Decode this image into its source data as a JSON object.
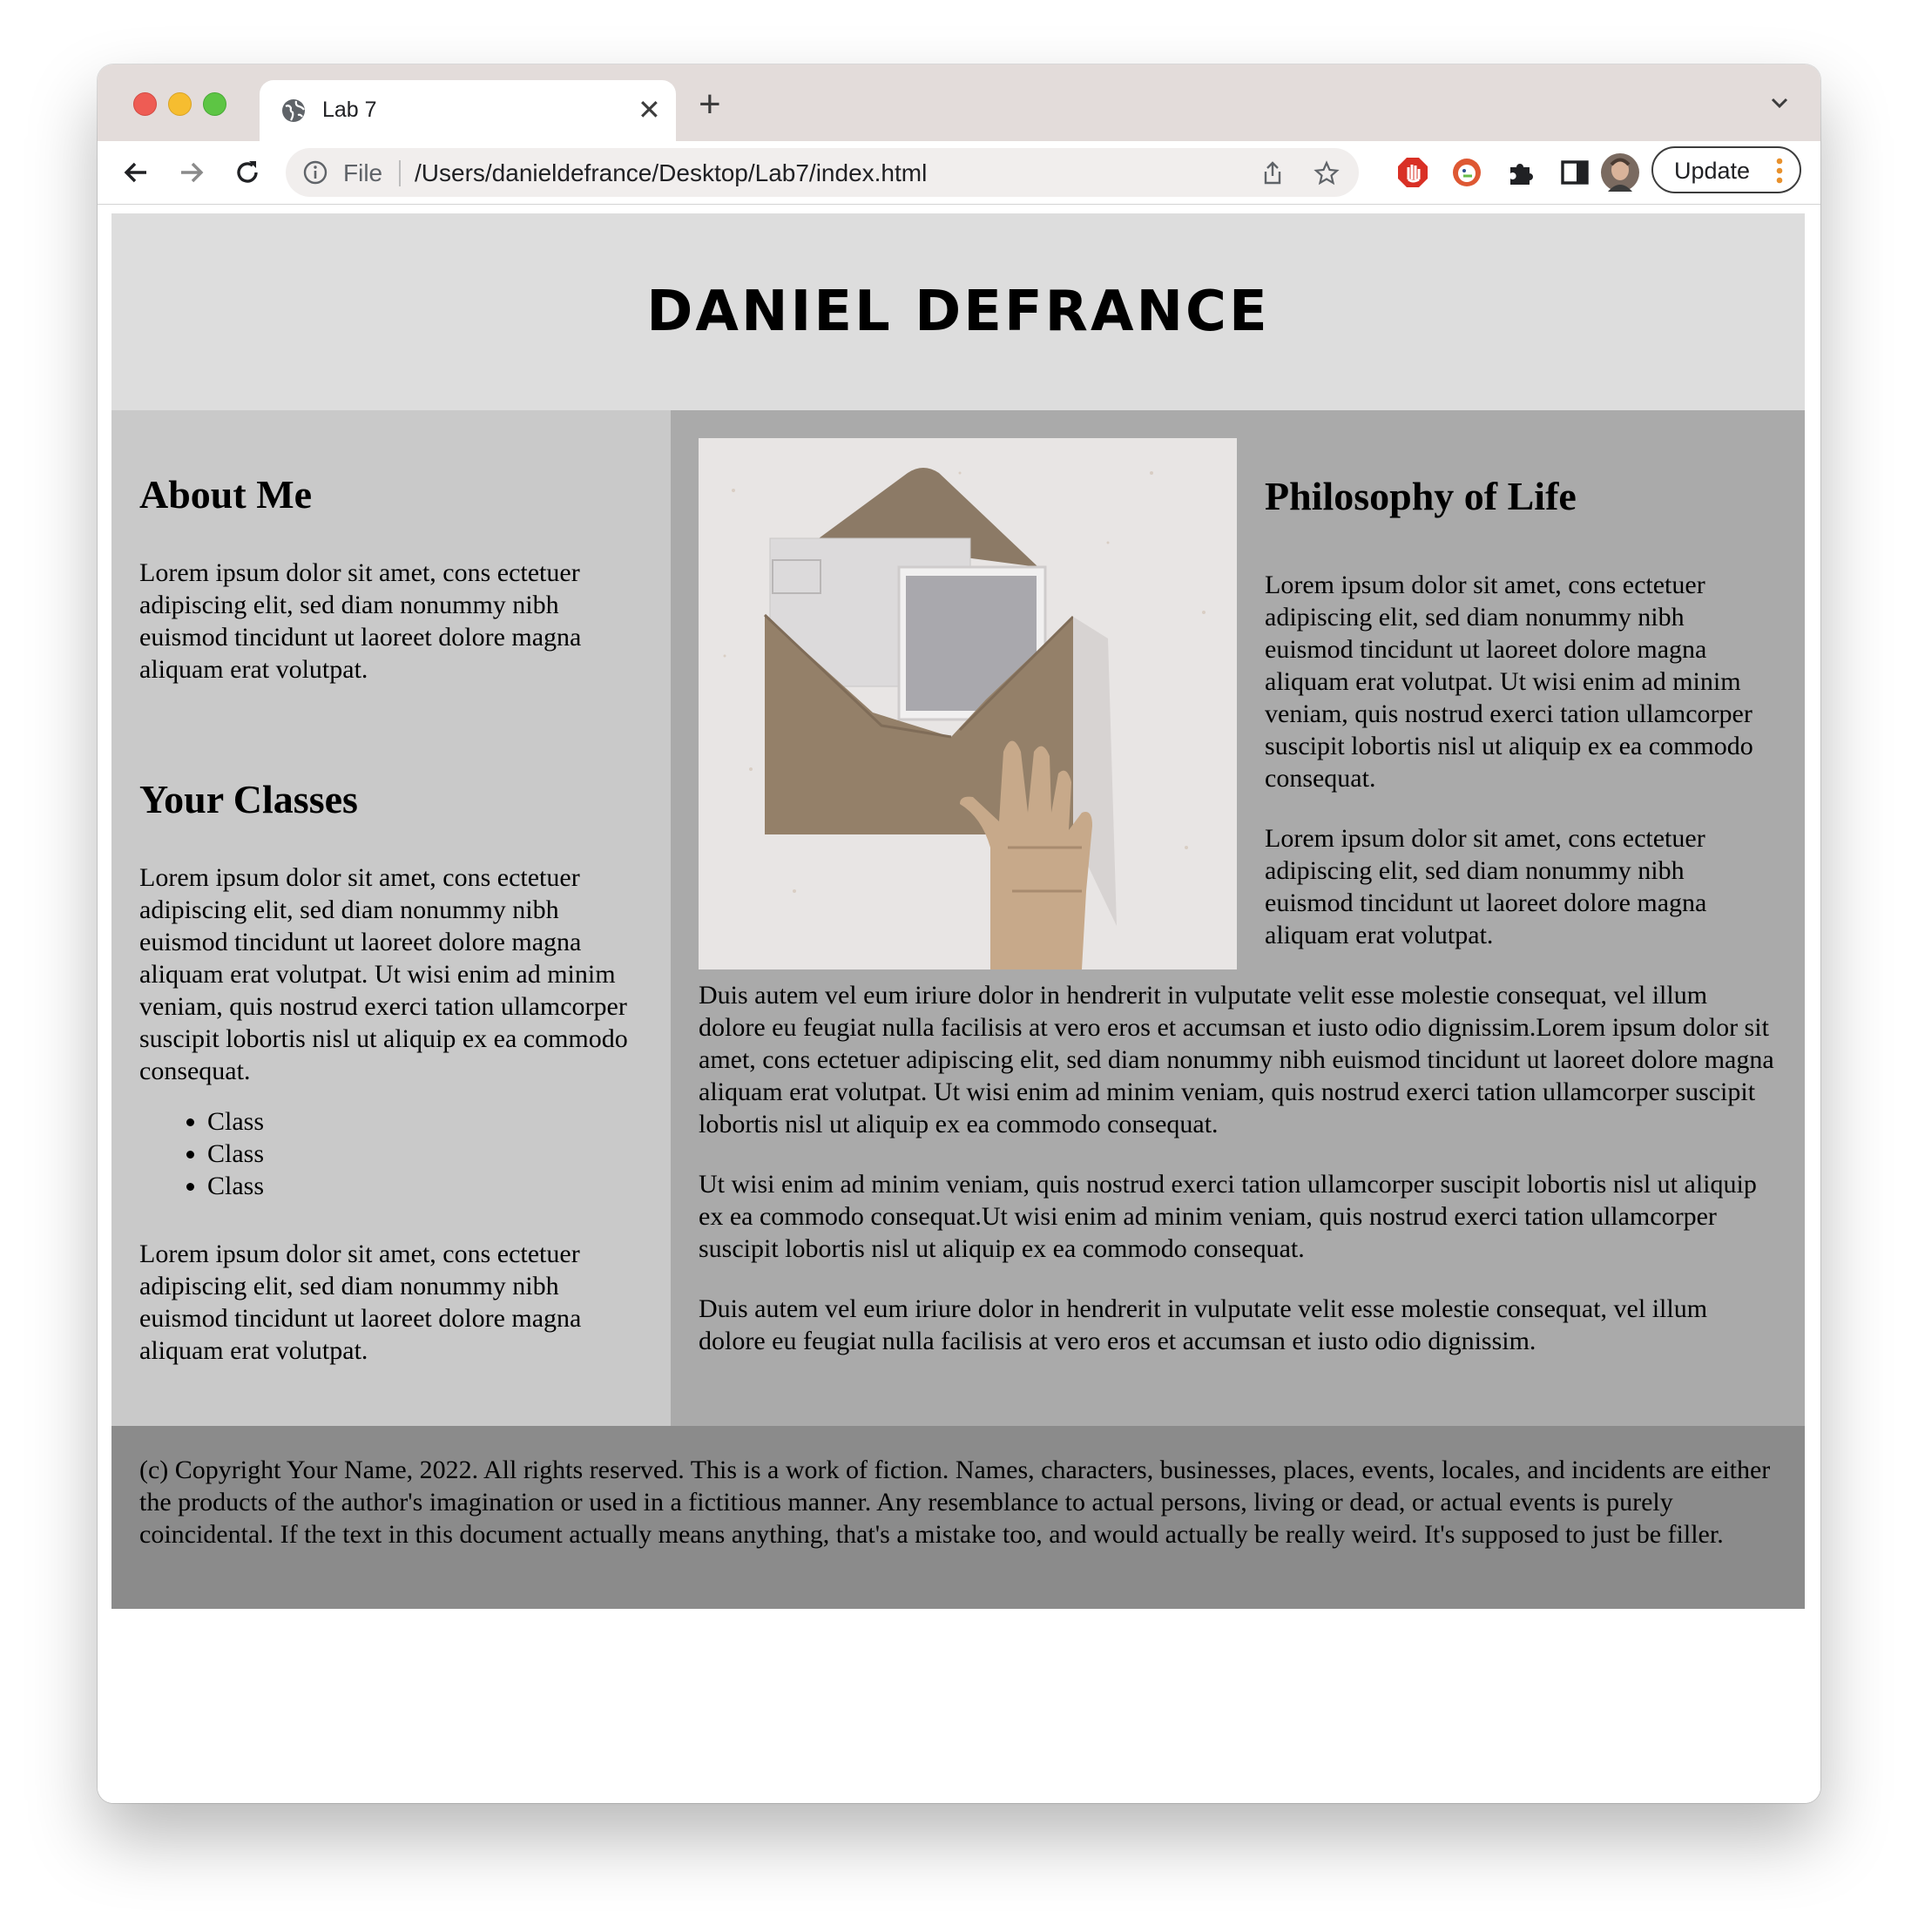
{
  "browser": {
    "tab_title": "Lab 7",
    "tab_close": "✕",
    "new_tab": "+",
    "url_scheme_label": "File",
    "url": "/Users/danieldefrance/Desktop/Lab7/index.html",
    "update_label": "Update",
    "colors": {
      "tabstrip": "#e3dcda",
      "omnibox": "#f1eeed",
      "close_red": "#ee5c54",
      "minimize_yellow": "#f6bd30",
      "maximize_green": "#5dc544"
    },
    "icons": [
      "globe-icon",
      "back-arrow-icon",
      "forward-arrow-icon",
      "reload-icon",
      "info-icon",
      "share-icon",
      "bookmark-star-icon",
      "adblock-icon",
      "duckduckgo-icon",
      "extensions-puzzle-icon",
      "side-panel-icon",
      "profile-avatar",
      "more-vert-icon",
      "tab-search-chevron-icon"
    ]
  },
  "page": {
    "site_title": "DANIEL DEFRANCE",
    "about": {
      "heading": "About Me",
      "text": "Lorem ipsum dolor sit amet, cons ectetuer adipiscing elit, sed diam nonummy nibh euismod tincidunt ut laoreet dolore magna aliquam erat volutpat."
    },
    "classes": {
      "heading": "Your Classes",
      "intro": "Lorem ipsum dolor sit amet, cons ectetuer adipiscing elit, sed diam nonummy nibh euismod tincidunt ut laoreet dolore magna aliquam erat volutpat. Ut wisi enim ad minim veniam, quis nostrud exerci tation ullamcorper suscipit lobortis nisl ut aliquip ex ea commodo consequat.",
      "items": [
        "Class",
        "Class",
        "Class"
      ],
      "outro": "Lorem ipsum dolor sit amet, cons ectetuer adipiscing elit, sed diam nonummy nibh euismod tincidunt ut laoreet dolore magna aliquam erat volutpat."
    },
    "philosophy": {
      "heading": "Philosophy of Life",
      "paragraphs": [
        "Lorem ipsum dolor sit amet, cons ectetuer adipiscing elit, sed diam nonummy nibh euismod tincidunt ut laoreet dolore magna aliquam erat volutpat. Ut wisi enim ad minim veniam, quis nostrud exerci tation ullamcorper suscipit lobortis nisl ut aliquip ex ea commodo consequat.",
        "Lorem ipsum dolor sit amet, cons ectetuer adipiscing elit, sed diam nonummy nibh euismod tincidunt ut laoreet dolore magna aliquam erat volutpat.",
        "Duis autem vel eum iriure dolor in hendrerit in vulputate velit esse molestie consequat, vel illum dolore eu feugiat nulla facilisis at vero eros et accumsan et iusto odio dignissim.Lorem ipsum dolor sit amet, cons ectetuer adipiscing elit, sed diam nonummy nibh euismod tincidunt ut laoreet dolore magna aliquam erat volutpat. Ut wisi enim ad minim veniam, quis nostrud exerci tation ullamcorper suscipit lobortis nisl ut aliquip ex ea commodo consequat.",
        "Ut wisi enim ad minim veniam, quis nostrud exerci tation ullamcorper suscipit lobortis nisl ut aliquip ex ea commodo consequat.Ut wisi enim ad minim veniam, quis nostrud exerci tation ullamcorper suscipit lobortis nisl ut aliquip ex ea commodo consequat.",
        "Duis autem vel eum iriure dolor in hendrerit in vulputate velit esse molestie consequat, vel illum dolore eu feugiat nulla facilisis at vero eros et accumsan et iusto odio dignissim."
      ]
    },
    "footer": "(c) Copyright Your Name, 2022. All rights reserved. This is a work of fiction. Names, characters, businesses, places, events, locales, and incidents are either the products of the author's imagination or used in a fictitious manner. Any resemblance to actual persons, living or dead, or actual events is purely coincidental. If the text in this document actually means anything, that's a mistake too, and would actually be really weird. It's supposed to just be filler.",
    "colors": {
      "header_bg": "#dddddd",
      "left_col_bg": "#c9c9c9",
      "right_col_bg": "#aaaaaa",
      "footer_bg": "#8b8b8b"
    }
  }
}
